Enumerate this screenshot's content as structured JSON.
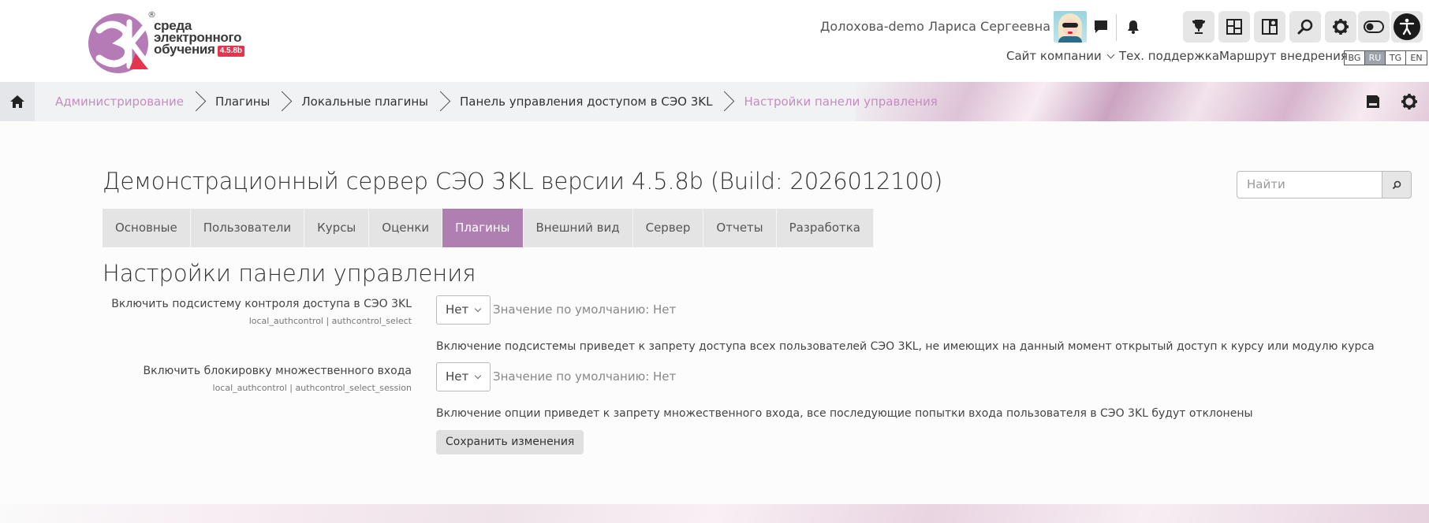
{
  "logo": {
    "line1": "среда",
    "line2": "электронного",
    "line3": "обучения",
    "version": "4.5.8b",
    "registered": "®",
    "brand": "3K",
    "colors": {
      "primary": "#b47bb6",
      "accent": "#e4344e"
    }
  },
  "header": {
    "user_name": "Долохова-demo Лариса Сергеевна",
    "links": {
      "company_site": "Сайт компании",
      "support": "Тех. поддержка",
      "roadmap": "Маршрут внедрения"
    },
    "languages": [
      {
        "code": "BG",
        "active": false
      },
      {
        "code": "RU",
        "active": true
      },
      {
        "code": "TG",
        "active": false
      },
      {
        "code": "EN",
        "active": false
      }
    ],
    "icons": [
      "chat-icon",
      "bell-icon",
      "trophy-icon",
      "dashboard-icon",
      "course-icon",
      "search-icon",
      "gear-icon",
      "toggle-icon",
      "accessibility-icon"
    ]
  },
  "breadcrumb": [
    {
      "label": "Администрирование",
      "style": "pink"
    },
    {
      "label": "Плагины",
      "style": "dark"
    },
    {
      "label": "Локальные плагины",
      "style": "dark"
    },
    {
      "label": "Панель управления доступом в СЭО 3KL",
      "style": "dark"
    },
    {
      "label": "Настройки панели управления",
      "style": "pink"
    }
  ],
  "page": {
    "heading": "Демонстрационный сервер СЭО 3KL версии 4.5.8b (Build: 2026012100)",
    "search_placeholder": "Найти",
    "tabs": [
      {
        "label": "Основные",
        "active": false
      },
      {
        "label": "Пользователи",
        "active": false
      },
      {
        "label": "Курсы",
        "active": false
      },
      {
        "label": "Оценки",
        "active": false
      },
      {
        "label": "Плагины",
        "active": true
      },
      {
        "label": "Внешний вид",
        "active": false
      },
      {
        "label": "Сервер",
        "active": false
      },
      {
        "label": "Отчеты",
        "active": false
      },
      {
        "label": "Разработка",
        "active": false
      }
    ],
    "section_title": "Настройки панели управления",
    "settings": [
      {
        "label": "Включить подсистему контроля доступа в СЭО 3KL",
        "key": "local_authcontrol | authcontrol_select",
        "value": "Нет",
        "default": "Значение по умолчанию: Нет",
        "description": "Включение подсистемы приведет к запрету доступа всех пользователей СЭО 3KL, не имеющих на данный момент открытый доступ к курсу или модулю курса"
      },
      {
        "label": "Включить блокировку множественного входа",
        "key": "local_authcontrol | authcontrol_select_session",
        "value": "Нет",
        "default": "Значение по умолчанию: Нет",
        "description": "Включение опции приведет к запрету множественного входа, все последующие попытки входа пользователя в СЭО 3KL будут отклонены"
      }
    ],
    "save_label": "Сохранить изменения"
  },
  "colors": {
    "active_tab": "#b07fb2",
    "breadcrumb_link": "#c58cc0"
  }
}
